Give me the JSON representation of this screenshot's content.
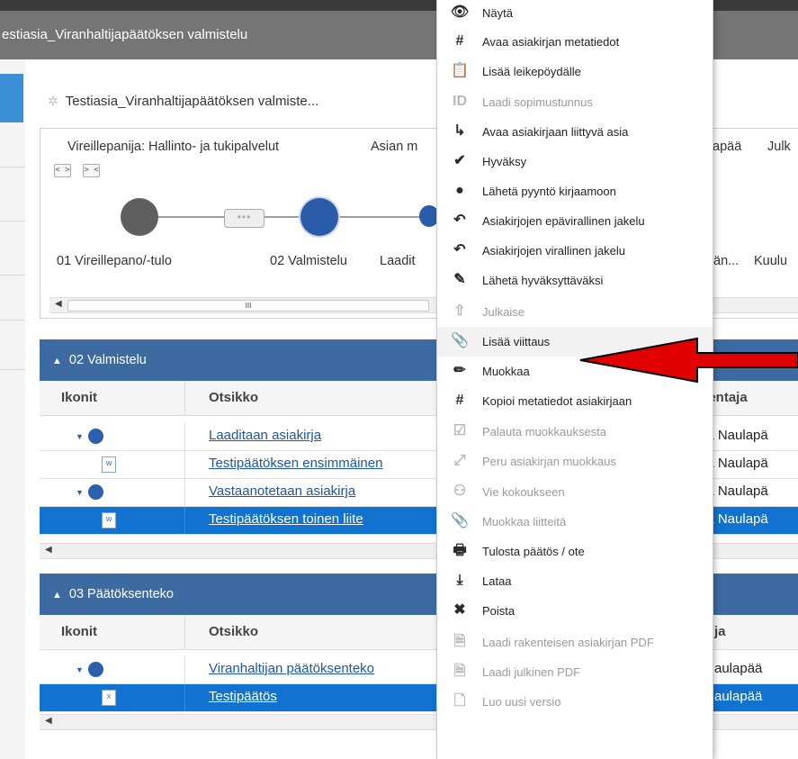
{
  "window_title": "estiasia_Viranhaltijapäätöksen valmistelu",
  "case": {
    "title": "Testiasia_Viranhaltijapäätöksen valmiste...",
    "info_left": "Vireillepanija: Hallinto- ja tukipalvelut",
    "info_mid": "Asian m",
    "info_right1": "apää",
    "info_right2": "Julk",
    "expand_btn": "< >",
    "collapse_btn": "> <",
    "steps_dots": "•••",
    "step1_label": "01 Vireillepano/-tulo",
    "step2_label": "02 Valmistelu",
    "step3_label": "Laadit",
    "step4_label": "än...",
    "step5_label": "Kuulu"
  },
  "scroll": {
    "left_arrow": "◀",
    "thumb": "III"
  },
  "section1": {
    "title": "02 Valmistelu",
    "col_icons": "Ikonit",
    "col_title": "Otsikko",
    "col_author": "llentaja",
    "rows": [
      {
        "title": "Laaditaan asiakirja",
        "author": "tta Naulapä"
      },
      {
        "title": "Testipäätöksen ensimmäinen",
        "author": "tta Naulapä"
      },
      {
        "title": "Vastaanotetaan asiakirja",
        "author": "tta Naulapä"
      },
      {
        "title": "Testipäätöksen toinen liite",
        "author": "tta Naulapä"
      }
    ]
  },
  "section2": {
    "title": "03 Päätöksenteko",
    "col_icons": "Ikonit",
    "col_title": "Otsikko",
    "col_author": "ja",
    "rows": [
      {
        "title": "Viranhaltijan päätöksenteko",
        "author": "aulapää"
      },
      {
        "title": "Testipäätös",
        "author": "aulapää"
      }
    ]
  },
  "menu": {
    "items": [
      {
        "icon": "eye-icon",
        "glyph": "👁",
        "label": "Näytä",
        "disabled": false
      },
      {
        "icon": "hash-icon",
        "glyph": "#",
        "label": "Avaa asiakirjan metatiedot",
        "disabled": false
      },
      {
        "icon": "clipboard-icon",
        "glyph": "📋",
        "label": "Lisää leikepöydälle",
        "disabled": false
      },
      {
        "icon": "id-icon",
        "glyph": "ID",
        "label": "Laadi sopimustunnus",
        "disabled": true
      },
      {
        "icon": "open-case-icon",
        "glyph": "↳",
        "label": "Avaa asiakirjaan liittyvä asia",
        "disabled": false
      },
      {
        "icon": "check-icon",
        "glyph": "✔",
        "label": "Hyväksy",
        "disabled": false
      },
      {
        "icon": "send-request-icon",
        "glyph": "●",
        "label": "Lähetä pyyntö kirjaamoon",
        "disabled": false
      },
      {
        "icon": "unofficial-share-icon",
        "glyph": "↶",
        "label": "Asiakirjojen epävirallinen jakelu",
        "disabled": false
      },
      {
        "icon": "official-share-icon",
        "glyph": "↶",
        "label": "Asiakirjojen virallinen jakelu",
        "disabled": false
      },
      {
        "icon": "send-approval-icon",
        "glyph": "✎",
        "label": "Lähetä hyväksyttäväksi",
        "disabled": false
      },
      {
        "icon": "publish-icon",
        "glyph": "⇧",
        "label": "Julkaise",
        "disabled": true
      },
      {
        "icon": "paperclip-icon",
        "glyph": "📎",
        "label": "Lisää viittaus",
        "disabled": false,
        "highlight": true
      },
      {
        "icon": "pencil-icon",
        "glyph": "✏",
        "label": "Muokkaa",
        "disabled": false
      },
      {
        "icon": "copy-metadata-icon",
        "glyph": "#",
        "label": "Kopioi metatiedot asiakirjaan",
        "disabled": false
      },
      {
        "icon": "restore-edit-icon",
        "glyph": "☑",
        "label": "Palauta muokkauksesta",
        "disabled": true
      },
      {
        "icon": "cancel-edit-icon",
        "glyph": "⤢",
        "label": "Peru asiakirjan muokkaus",
        "disabled": true
      },
      {
        "icon": "meeting-icon",
        "glyph": "⚇",
        "label": "Vie kokoukseen",
        "disabled": true
      },
      {
        "icon": "attachment-edit-icon",
        "glyph": "📎",
        "label": "Muokkaa liitteitä",
        "disabled": true
      },
      {
        "icon": "printer-icon",
        "glyph": "🖶",
        "label": "Tulosta päätös / ote",
        "disabled": false
      },
      {
        "icon": "download-icon",
        "glyph": "⤓",
        "label": "Lataa",
        "disabled": false
      },
      {
        "icon": "delete-icon",
        "glyph": "✖",
        "label": "Poista",
        "disabled": false
      },
      {
        "icon": "pdf-structured-icon",
        "glyph": "🗎",
        "label": "Laadi rakenteisen asiakirjan PDF",
        "disabled": true
      },
      {
        "icon": "pdf-public-icon",
        "glyph": "🗎",
        "label": "Laadi julkinen PDF",
        "disabled": true
      },
      {
        "icon": "new-version-icon",
        "glyph": "🗋",
        "label": "Luo uusi versio",
        "disabled": true
      }
    ]
  },
  "colors": {
    "section_header": "#3d6aa0",
    "selected_row": "#1172cf",
    "arrow": "#e00000"
  }
}
